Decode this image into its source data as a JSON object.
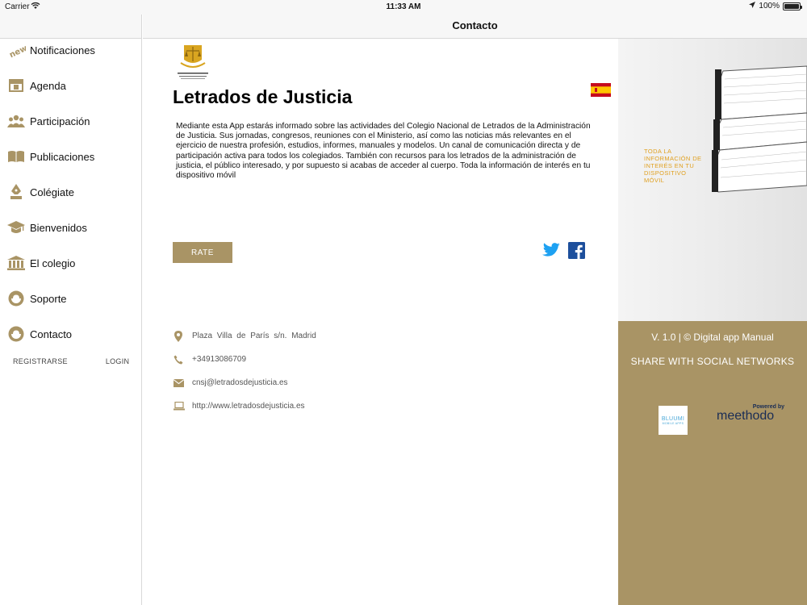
{
  "status_bar": {
    "carrier": "Carrier",
    "time": "11:33 AM",
    "battery": "100%",
    "battery_level": 1.0
  },
  "nav": {
    "title": "Contacto"
  },
  "sidebar": {
    "items": [
      {
        "label": "Notificaciones",
        "icon": "new-badge-icon"
      },
      {
        "label": "Agenda",
        "icon": "calendar-icon"
      },
      {
        "label": "Participación",
        "icon": "people-icon"
      },
      {
        "label": "Publicaciones",
        "icon": "open-book-icon"
      },
      {
        "label": "Colégiate",
        "icon": "pen-nib-icon"
      },
      {
        "label": "Bienvenidos",
        "icon": "graduation-cap-icon"
      },
      {
        "label": "El colegio",
        "icon": "building-columns-icon"
      },
      {
        "label": "Soporte",
        "icon": "support-agent-icon"
      },
      {
        "label": "Contacto",
        "icon": "contact-agent-icon"
      }
    ],
    "register": "REGISTRARSE",
    "login": "LOGIN"
  },
  "main": {
    "title": "Letrados de Justicia",
    "description": "Mediante esta App estarás informado sobre las actividades del Colegio Nacional de Letrados de la Administración de Justicia. Sus jornadas, congresos, reuniones con el Ministerio, así como las noticias más relevantes en el ejercicio de nuestra profesión, estudios, informes, manuales y modelos.  Un canal de comunicación directa y de participación activa para todos los colegiados. También con recursos para los letrados de la administración de justicia, el público interesado, y por supuesto si acabas de acceder al cuerpo. Toda la información de interés en tu dispositivo móvil",
    "rate_label": "RATE",
    "contact": {
      "address": "Plaza Villa de París s/n. Madrid",
      "phone": "+34913086709",
      "email": "cnsj@letradosdejusticia.es",
      "web": "http://www.letradosdejusticia.es"
    }
  },
  "right_panel": {
    "promo": "TODA LA INFORMACIÓN DE INTERÉS EN TU DISPOSITIVO MÓVIL",
    "version": "V. 1.0 | © Digital app Manual",
    "share": "SHARE WITH SOCIAL NETWORKS",
    "bluumi_name": "BLUUMI",
    "bluumi_sub": "MOBILE APPS",
    "powered_by": "Powered by",
    "meethodo_name": "meethodo"
  },
  "colors": {
    "accent": "#a99465",
    "twitter": "#1da1f2",
    "facebook": "#1d4f9c",
    "promo_text": "#e0a020"
  }
}
